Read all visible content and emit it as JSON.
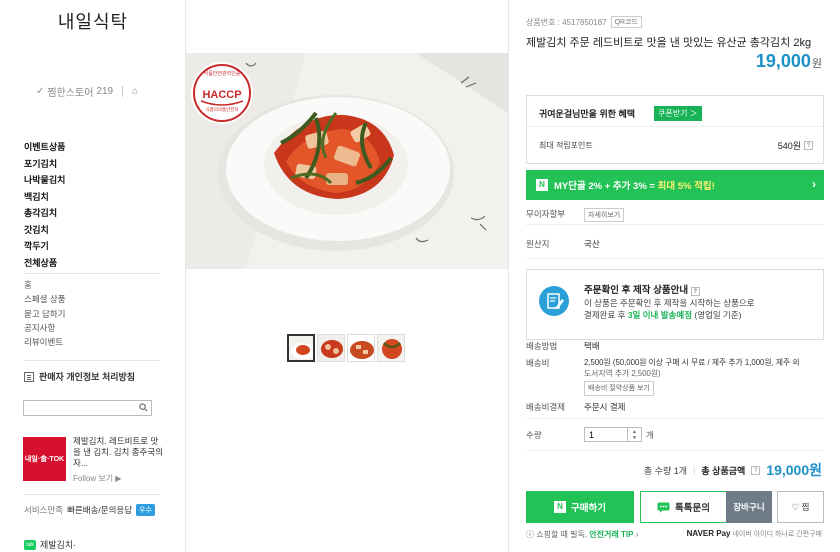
{
  "store": {
    "name": "내일식탁",
    "zzim_label": "찜한스토어",
    "zzim_count": "219"
  },
  "categories": [
    "이벤트상품",
    "포기김치",
    "나박물김치",
    "백김치",
    "총각김치",
    "갓김치",
    "깍두기",
    "전체상품"
  ],
  "sub_menu": [
    "홈",
    "스페셜 상품",
    "묻고 답하기",
    "공지사항",
    "리뷰이벤트"
  ],
  "privacy_label": "판매자 개인정보 처리방침",
  "search": {
    "placeholder": ""
  },
  "promo": {
    "thumb_text": "내일·食·TOK",
    "text": "제발김치. 레드비트로 맛을 낸 김치. 김치 종주국의 자...",
    "more": "Follow 보기"
  },
  "service": {
    "label": "서비스만족",
    "value": "빠른배송/문의응답",
    "badge": "우수"
  },
  "talk_label": "제발김치·",
  "product": {
    "number_label": "상품번호 : 4517850187",
    "qr_label": "QR코드",
    "title": "제발김치 주문 레드비트로 맛을 낸 맛있는 유산균 총각김치 2kg",
    "price": "19,000",
    "price_unit": "원"
  },
  "benefit": {
    "title": "귀여운걸님만을 위한 혜택",
    "coupon_btn": "쿠폰받기 ＞",
    "point_label": "최대 적립포인트",
    "point_value": "540원"
  },
  "mydan": {
    "n": "N",
    "text_a": "MY단골 2% + 추가 3% = ",
    "text_b": "최대 5% 적립!",
    "arrow": "›"
  },
  "rows": {
    "interest_free_label": "무이자할부",
    "interest_free_btn": "자세히보기",
    "origin_label": "원산지",
    "origin_value": "국산",
    "ship_method_label": "배송방법",
    "ship_method_value": "택배",
    "ship_fee_label": "배송비",
    "ship_fee_value": "2,500원 (50,000원 이상 구매 시 무료 / 제주 추가 1,000원, 제주 외",
    "ship_fee_value2": "도서지역 추가 2,500원)",
    "ship_fee_btn": "배송비 절약상품 보기",
    "ship_pay_label": "배송비결제",
    "ship_pay_value": "주문시 결제",
    "qty_label": "수량",
    "qty_value": "1",
    "qty_unit": "개"
  },
  "made": {
    "title": "주문확인 후 제작 상품안내",
    "line1": "이 상품은 주문확인 후 제작을 시작하는 상품으로",
    "line2a": "결제완료 후 ",
    "line2b": "3일 이내 발송예정",
    "line2c": " (영업일 기준)"
  },
  "total": {
    "count_label": "총 수량 1개",
    "amount_label": "총 상품금액",
    "amount": "19,000원"
  },
  "buttons": {
    "buy": "구매하기",
    "buy_n": "N",
    "talk": "톡톡문의",
    "cart": "장바구니",
    "zzim": "♡ 찜"
  },
  "tip": {
    "a": "쇼핑할 때 필독, ",
    "b": "안전거래 TIP",
    "c": " ›"
  },
  "npay": {
    "brand": "NAVER Pay",
    "text": " 네이버 아이디 하나로 간편구매"
  },
  "colors": {
    "accent_blue": "#1d91c7",
    "naver_green": "#22c256",
    "promo_red": "#d6112f"
  }
}
